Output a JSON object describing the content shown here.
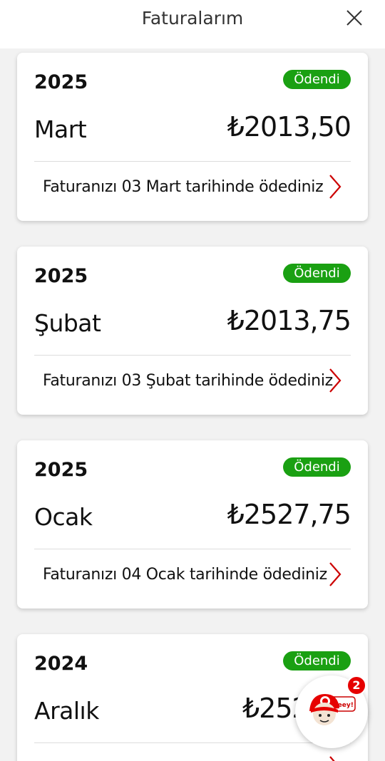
{
  "header": {
    "title": "Faturalarım"
  },
  "bills": [
    {
      "year": "2025",
      "status": "Ödendi",
      "month": "Mart",
      "amount": "₺2013,50",
      "note": "Faturanızı 03 Mart tarihinde ödediniz"
    },
    {
      "year": "2025",
      "status": "Ödendi",
      "month": "Şubat",
      "amount": "₺2013,75",
      "note": "Faturanızı 03 Şubat tarihinde ödediniz"
    },
    {
      "year": "2025",
      "status": "Ödendi",
      "month": "Ocak",
      "amount": "₺2527,75",
      "note": "Faturanızı 04 Ocak tarihinde ödediniz"
    },
    {
      "year": "2024",
      "status": "Ödendi",
      "month": "Aralık",
      "amount": "₺252",
      "note": ""
    }
  ],
  "assistant": {
    "badge_count": "2",
    "bubble_text": "Heey!"
  },
  "colors": {
    "paid_badge": "#1aa012",
    "chevron": "#cc0000",
    "notification": "#e60000"
  }
}
